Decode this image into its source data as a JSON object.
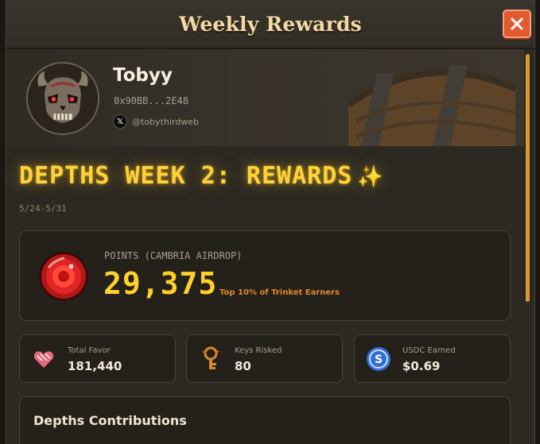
{
  "window": {
    "title": "Weekly Rewards",
    "close_icon": "close-icon"
  },
  "profile": {
    "username": "Tobyy",
    "wallet": "0x90BB...2E48",
    "social_icon": "x-logo-icon",
    "handle": "@tobythirdweb",
    "avatar": "skull-avatar"
  },
  "week": {
    "title": "DEPTHS WEEK 2: REWARDS",
    "sparkle": "✨",
    "date_range": "5/24-5/31"
  },
  "points": {
    "label": "POINTS (CAMBRIA AIRDROP)",
    "value": "29,375",
    "rank": "Top 10% of Trinket Earners",
    "icon": "red-gem-icon"
  },
  "stats": [
    {
      "label": "Total Favor",
      "value": "181,440",
      "icon": "favor-heart-icon"
    },
    {
      "label": "Keys Risked",
      "value": "80",
      "icon": "key-icon"
    },
    {
      "label": "USDC Earned",
      "value": "$0.69",
      "icon": "usdc-coin-icon"
    }
  ],
  "contributions": {
    "title": "Depths Contributions"
  },
  "colors": {
    "accent_gold": "#ffd23a",
    "close_red": "#e25a32",
    "rank_orange": "#e0882e",
    "panel": "#24211b"
  }
}
